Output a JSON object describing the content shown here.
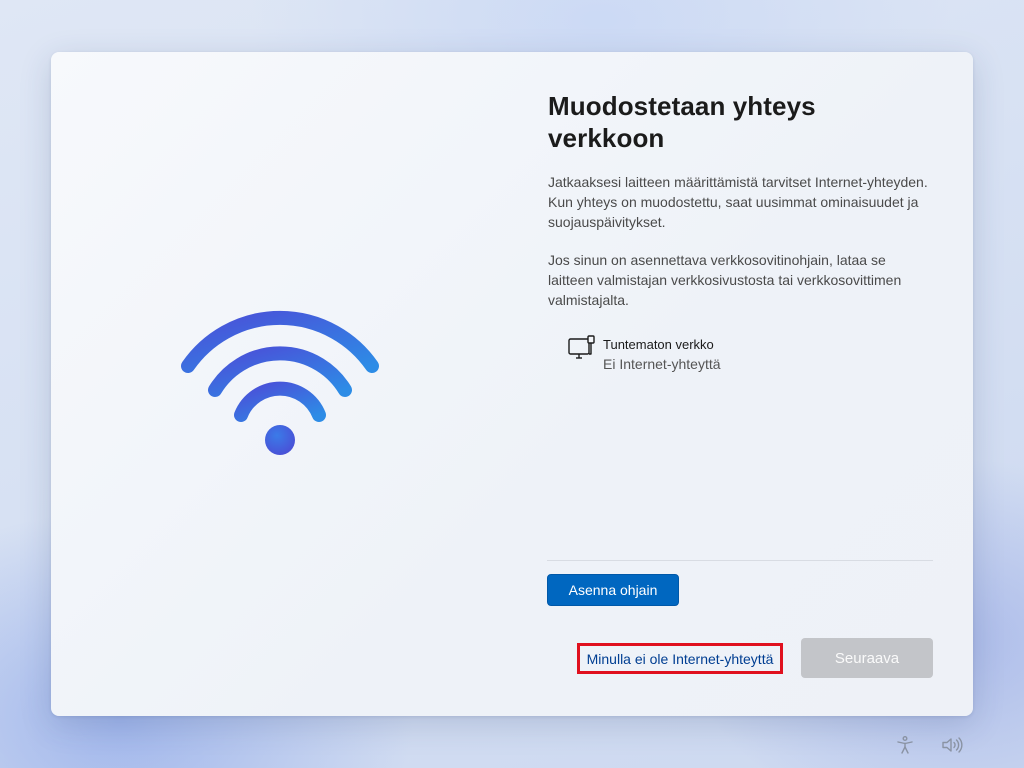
{
  "dialog": {
    "title": "Muodostetaan yhteys verkkoon",
    "paragraph1": "Jatkaaksesi laitteen määrittämistä tarvitset Internet-yhteyden. Kun yhteys on muodostettu, saat uusimmat ominaisuudet ja suojauspäivitykset.",
    "paragraph2": "Jos sinun on asennettava verkkosovitinohjain, lataa se laitteen valmistajan verkkosivustosta tai verkkosovittimen valmistajalta."
  },
  "network": {
    "icon": "wired-network-icon",
    "name": "Tuntematon verkko",
    "status": "Ei Internet-yhteyttä"
  },
  "buttons": {
    "install_driver": "Asenna ohjain",
    "no_internet": "Minulla ei ole Internet-yhteyttä",
    "next": "Seuraava"
  },
  "hero": {
    "icon": "wifi-icon"
  },
  "tray": {
    "accessibility_icon": "accessibility-icon",
    "volume_icon": "volume-icon"
  },
  "colors": {
    "accent": "#0067c0",
    "link": "#003e92",
    "highlight_box": "#e0101e",
    "disabled_button": "#c3c5c9",
    "wifi_gradient_start": "#4b4fd8",
    "wifi_gradient_end": "#2d8ce6"
  }
}
